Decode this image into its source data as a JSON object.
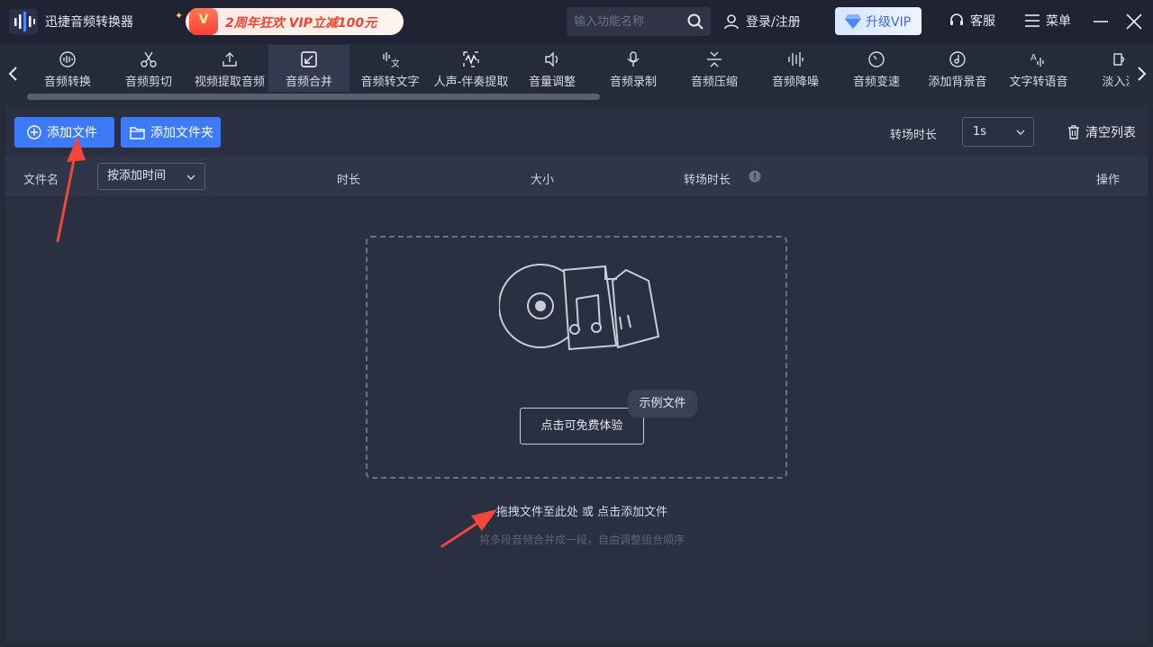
{
  "app": {
    "title": "迅捷音频转换器"
  },
  "promo": {
    "badge": "V",
    "text": "2周年狂欢 VIP立减100元"
  },
  "search": {
    "placeholder": "输入功能名称"
  },
  "header": {
    "login": "登录/注册",
    "vip": "升级VIP",
    "service": "客服",
    "menu": "菜单"
  },
  "tools": [
    {
      "label": "音频转换",
      "icon": "waveform-circle-icon"
    },
    {
      "label": "音频剪切",
      "icon": "scissors-icon"
    },
    {
      "label": "视频提取音频",
      "icon": "upload-icon"
    },
    {
      "label": "音频合并",
      "icon": "merge-icon",
      "active": true
    },
    {
      "label": "音频转文字",
      "icon": "speech-to-text-icon"
    },
    {
      "label": "人声-伴奏提取",
      "icon": "vocal-extract-icon"
    },
    {
      "label": "音量调整",
      "icon": "volume-icon"
    },
    {
      "label": "音频录制",
      "icon": "microphone-icon"
    },
    {
      "label": "音频压缩",
      "icon": "compress-icon"
    },
    {
      "label": "音频降噪",
      "icon": "denoise-icon"
    },
    {
      "label": "音频变速",
      "icon": "speed-icon"
    },
    {
      "label": "添加背景音",
      "icon": "music-disc-icon"
    },
    {
      "label": "文字转语音",
      "icon": "text-to-speech-icon"
    },
    {
      "label": "淡入淡",
      "icon": "fade-icon"
    }
  ],
  "actions": {
    "add_file": "添加文件",
    "add_folder": "添加文件夹",
    "transition_label": "转场时长",
    "transition_value": "1s",
    "clear_list": "清空列表"
  },
  "table": {
    "col_filename": "文件名",
    "sort_value": "按添加时间",
    "col_duration": "时长",
    "col_size": "大小",
    "col_transition": "转场时长",
    "col_actions": "操作"
  },
  "dropzone": {
    "try_button": "点击可免费体验",
    "sample_badge": "示例文件",
    "hint": "拖拽文件至此处 或 点击添加文件",
    "sub_hint": "将多段音频合并成一段，自由调整组合顺序"
  },
  "colors": {
    "accent": "#3d7bf6",
    "annotation_arrow": "#f0473a"
  }
}
